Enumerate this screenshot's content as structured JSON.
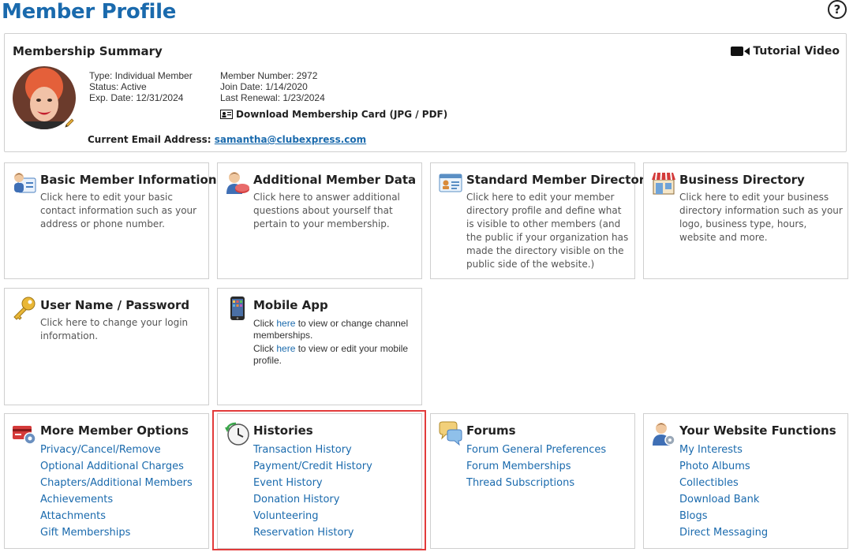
{
  "page": {
    "title": "Member Profile",
    "help_icon": "help-icon"
  },
  "summary": {
    "heading": "Membership Summary",
    "tutorial_label": "Tutorial Video",
    "type_line": "Type: Individual Member",
    "status_line": "Status: Active",
    "exp_line": "Exp. Date: 12/31/2024",
    "number_line": "Member Number: 2972",
    "join_line": "Join Date: 1/14/2020",
    "renewal_line": "Last Renewal: 1/23/2024",
    "download_prefix": "Download Membership Card (",
    "download_jpg": "JPG",
    "download_sep": " / ",
    "download_pdf": "PDF",
    "download_suffix": ")",
    "email_label": "Current Email Address:",
    "email": "samantha@clubexpress.com"
  },
  "cards": {
    "basic": {
      "title": "Basic Member Information",
      "desc": "Click here to edit your basic contact information such as your address or phone number."
    },
    "additional": {
      "title": "Additional Member Data",
      "desc": "Click here to answer additional questions about yourself that pertain to your membership."
    },
    "directory": {
      "title": "Standard Member Directory",
      "desc": "Click here to edit your member directory profile and define what is visible to other members (and the public if your organization has made the directory visible on the public side of the website.)"
    },
    "business": {
      "title": "Business Directory",
      "desc": "Click here to edit your business directory information such as your logo, business type, hours, website and more."
    },
    "username": {
      "title": "User Name / Password",
      "desc": "Click here to change your login information."
    },
    "mobile": {
      "title": "Mobile App",
      "line1_pre": "Click ",
      "line1_link": "here",
      "line1_post": " to view or change channel memberships.",
      "line2_pre": "Click ",
      "line2_link": "here",
      "line2_post": " to view or edit your mobile profile."
    },
    "more": {
      "title": "More Member Options",
      "links": [
        "Privacy/Cancel/Remove",
        "Optional Additional Charges",
        "Chapters/Additional Members",
        "Achievements",
        "Attachments",
        "Gift Memberships"
      ]
    },
    "histories": {
      "title": "Histories",
      "links": [
        "Transaction History",
        "Payment/Credit History",
        "Event History",
        "Donation History",
        "Volunteering",
        "Reservation History"
      ]
    },
    "forums": {
      "title": "Forums",
      "links": [
        "Forum General Preferences",
        "Forum Memberships",
        "Thread Subscriptions"
      ]
    },
    "website": {
      "title": "Your Website Functions",
      "links": [
        "My Interests",
        "Photo Albums",
        "Collectibles",
        "Download Bank",
        "Blogs",
        "Direct Messaging"
      ]
    }
  },
  "colors": {
    "link": "#1a6aad",
    "highlight": "#e23b3b",
    "border": "#cfcfcf"
  }
}
